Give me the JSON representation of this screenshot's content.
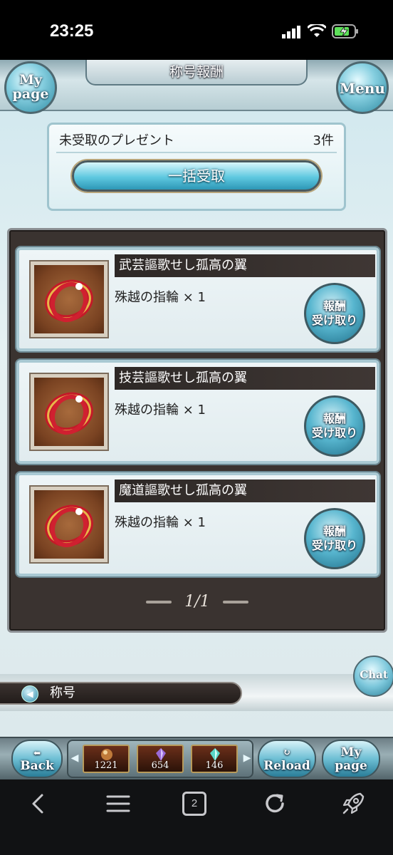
{
  "status": {
    "time": "23:25"
  },
  "header": {
    "title": "称号報酬",
    "mypage_label": [
      "My",
      "page"
    ],
    "menu_label": "Menu"
  },
  "present": {
    "label": "未受取のプレゼント",
    "count": "3件",
    "bulk_button": "一括受取"
  },
  "rewards": [
    {
      "title": "武芸謳歌せし孤高の翼",
      "item": "殊越の指輪 × 1",
      "claim": [
        "報酬",
        "受け取り"
      ]
    },
    {
      "title": "技芸謳歌せし孤高の翼",
      "item": "殊越の指輪 × 1",
      "claim": [
        "報酬",
        "受け取り"
      ]
    },
    {
      "title": "魔道謳歌せし孤高の翼",
      "item": "殊越の指輪 × 1",
      "claim": [
        "報酬",
        "受け取り"
      ]
    }
  ],
  "pager": "1/1",
  "chat_label": "Chat",
  "breadcrumb": "称号",
  "bottombar": {
    "back": "Back",
    "reload": "Reload",
    "mypage": [
      "My",
      "page"
    ],
    "items": [
      {
        "count": "1221",
        "icon": "orb-icon",
        "color": "#c07a3a"
      },
      {
        "count": "654",
        "icon": "crystal-icon",
        "color": "#9a6ad8"
      },
      {
        "count": "146",
        "icon": "cyan-crystal-icon",
        "color": "#5ad6c8"
      }
    ]
  },
  "browser": {
    "tab_count": "2"
  }
}
